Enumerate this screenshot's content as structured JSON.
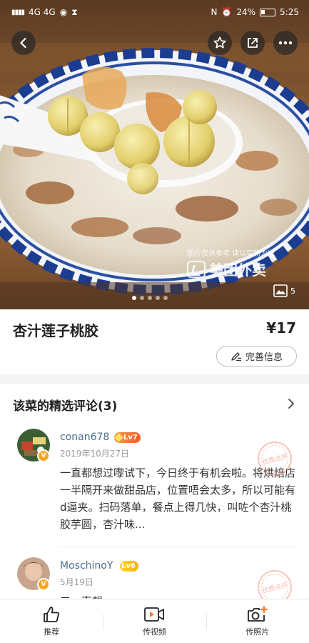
{
  "status_bar": {
    "left_text": "4G 4G",
    "battery": "24%",
    "time": "5:25"
  },
  "nav": {
    "back_icon": "chevron-left-icon",
    "favorite_icon": "star-outline-icon",
    "share_icon": "share-icon",
    "more_icon": "more-horizontal-icon"
  },
  "hero": {
    "disclaimer": "图片仅供参考 请以实物为准",
    "brand_watermark": "美团外卖",
    "photo_count": "5",
    "carousel_total": 5,
    "carousel_active": 1
  },
  "dish": {
    "name": "杏汁莲子桃胶",
    "price": "¥17",
    "improve_button": "完善信息"
  },
  "reviews": {
    "section_title": "该菜的精选评论(3)",
    "items": [
      {
        "username": "conan678",
        "level": "Lv7",
        "avatar_badge": "V",
        "date": "2019年10月27日",
        "text": "一直都想过嚟试下，今日终于有机会啦。将烘焙店一半隔开来做甜品店，位置唔会太多，所以可能有d逼夹。扫码落单，餐点上得几快，叫咗个杏汁桃胶芋圆，杏汁味...",
        "stamp": "优质点评"
      },
      {
        "username": "MoschinoY",
        "level": "Lv6",
        "avatar_badge": "V",
        "date": "5月19日",
        "text": "三一直想...",
        "stamp": "优质点评"
      }
    ]
  },
  "bottom_bar": {
    "tabs": [
      {
        "label": "推荐",
        "icon": "thumbs-up-icon"
      },
      {
        "label": "传视频",
        "icon": "video-camera-icon"
      },
      {
        "label": "传照片",
        "icon": "camera-add-icon"
      }
    ]
  },
  "colors": {
    "username": "#4a6c8f",
    "lv7_badge": "#f25b2b",
    "lv6_badge": "#f5b400",
    "avatar_badge": "#f5a623",
    "stamp": "#eb5a3c"
  }
}
